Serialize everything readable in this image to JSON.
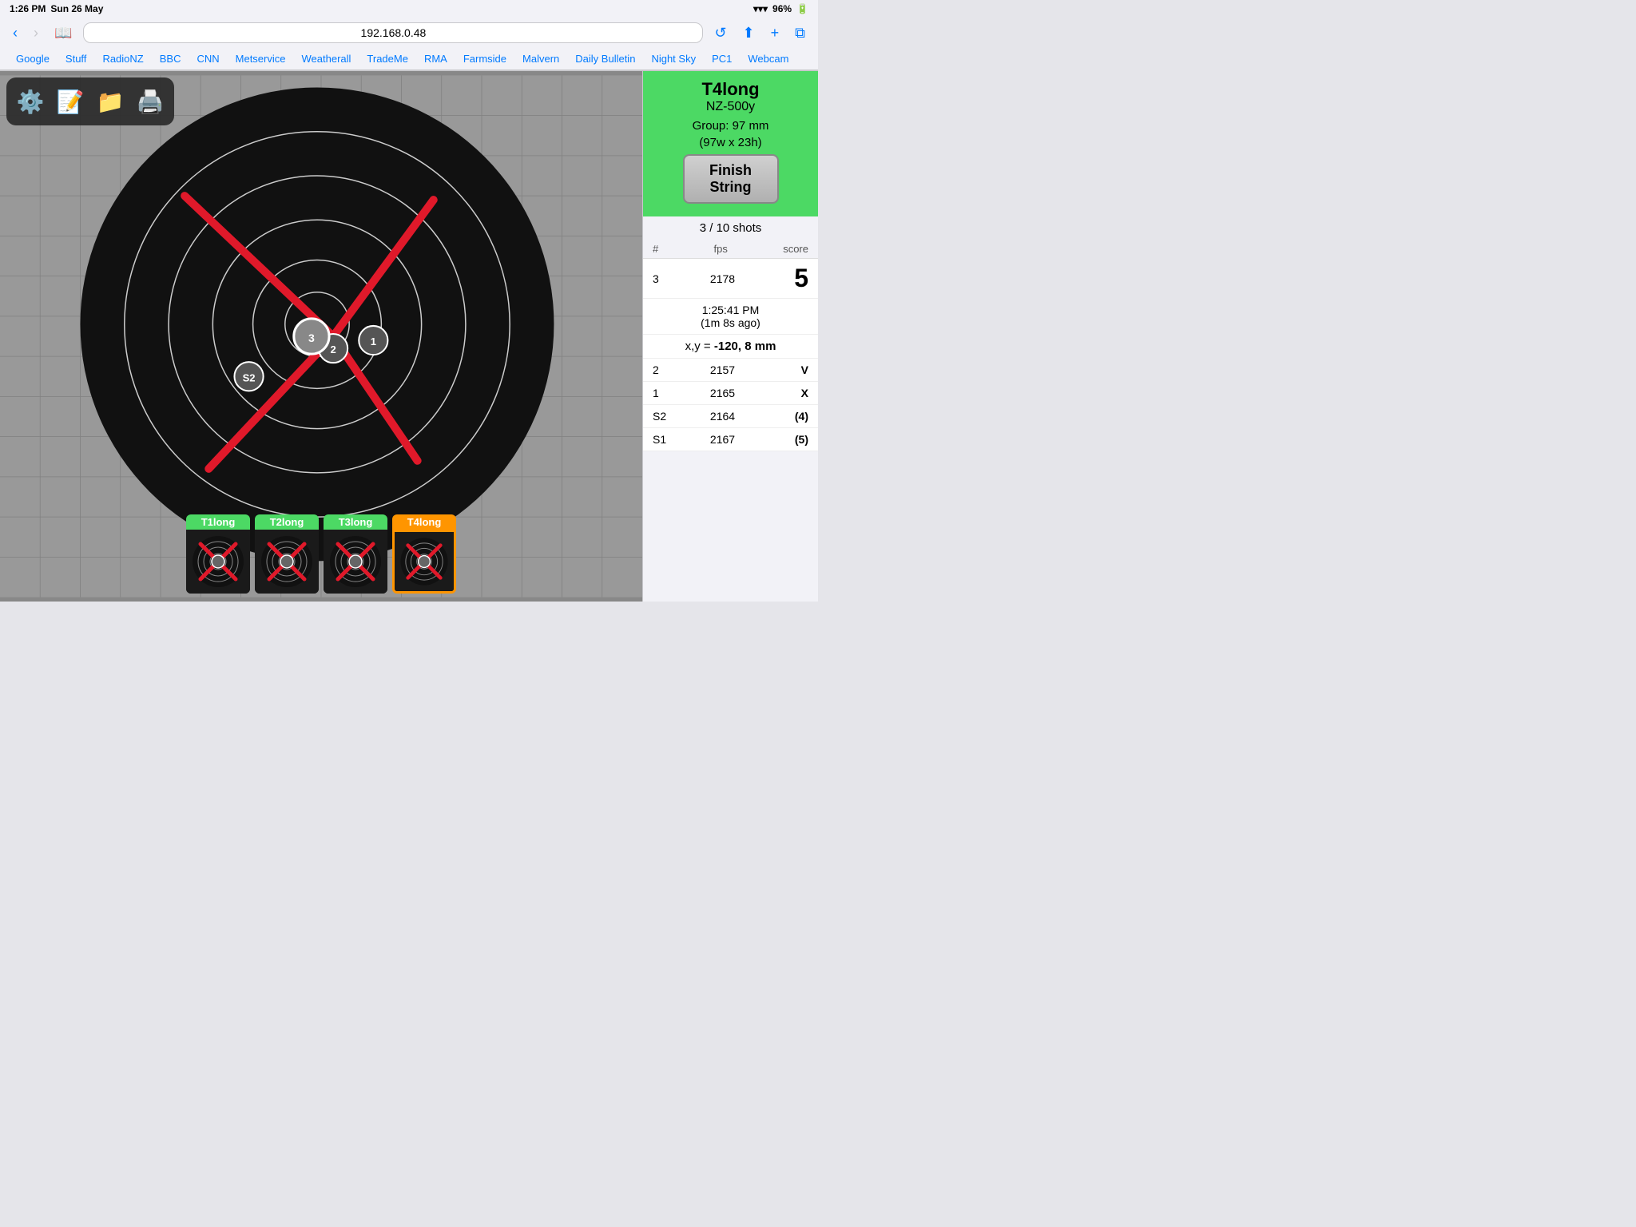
{
  "status_bar": {
    "time": "1:26 PM",
    "date": "Sun 26 May",
    "wifi": "WiFi",
    "battery": "96%"
  },
  "browser": {
    "url": "192.168.0.48",
    "back_label": "‹",
    "forward_label": "›",
    "bookmarks_icon": "📖",
    "reload_icon": "↺",
    "share_icon": "⬆",
    "add_icon": "+",
    "tabs_icon": "⧉"
  },
  "bookmarks": [
    "Google",
    "Stuff",
    "RadioNZ",
    "BBC",
    "CNN",
    "Metservice",
    "Weatherall",
    "TradeMe",
    "RMA",
    "Farmside",
    "Malvern",
    "Daily Bulletin",
    "Night Sky",
    "PC1",
    "Webcam"
  ],
  "toolbar": {
    "settings_icon": "⚙️",
    "notes_icon": "📝",
    "folder_icon": "📁",
    "print_icon": "🖨️"
  },
  "session": {
    "title": "T4long",
    "subtitle": "NZ-500y",
    "group_label": "Group: 97 mm",
    "group_detail": "(97w x 23h)",
    "finish_string_label": "Finish\nString",
    "shots_count": "3 / 10 shots"
  },
  "shots_table": {
    "col_num": "#",
    "col_fps": "fps",
    "col_score": "score",
    "highlighted_shot": {
      "num": "3",
      "fps": "2178",
      "score": "5",
      "time": "1:25:41 PM",
      "ago": "(1m 8s ago)",
      "x": "-120",
      "y": "8",
      "xy_label": "x,y ="
    },
    "other_shots": [
      {
        "num": "2",
        "fps": "2157",
        "score": "V"
      },
      {
        "num": "1",
        "fps": "2165",
        "score": "X"
      },
      {
        "num": "S2",
        "fps": "2164",
        "score": "(4)"
      },
      {
        "num": "S1",
        "fps": "2167",
        "score": "(5)"
      }
    ]
  },
  "thumbnails": [
    {
      "label": "T1long",
      "active": false
    },
    {
      "label": "T2long",
      "active": false
    },
    {
      "label": "T3long",
      "active": false
    },
    {
      "label": "T4long",
      "active": true
    }
  ],
  "colors": {
    "green": "#4cd964",
    "orange": "#ff9500",
    "red": "#e0192a"
  }
}
